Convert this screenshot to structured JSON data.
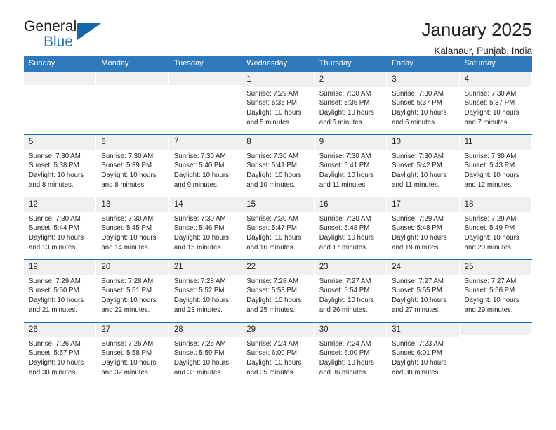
{
  "brand": {
    "name_top": "General",
    "name_bottom": "Blue",
    "triangle_color": "#1567ab",
    "blue_text_color": "#2572b6"
  },
  "header": {
    "title": "January 2025",
    "subtitle": "Kalanaur, Punjab, India"
  },
  "theme": {
    "header_band": "#2f79bd",
    "row_divider": "#1d6cae",
    "daynum_band": "#f0f0f0"
  },
  "weekdays": [
    "Sunday",
    "Monday",
    "Tuesday",
    "Wednesday",
    "Thursday",
    "Friday",
    "Saturday"
  ],
  "weeks": [
    [
      {
        "day": "",
        "sunrise": "",
        "sunset": "",
        "daylight1": "",
        "daylight2": ""
      },
      {
        "day": "",
        "sunrise": "",
        "sunset": "",
        "daylight1": "",
        "daylight2": ""
      },
      {
        "day": "",
        "sunrise": "",
        "sunset": "",
        "daylight1": "",
        "daylight2": ""
      },
      {
        "day": "1",
        "sunrise": "Sunrise: 7:29 AM",
        "sunset": "Sunset: 5:35 PM",
        "daylight1": "Daylight: 10 hours",
        "daylight2": "and 5 minutes."
      },
      {
        "day": "2",
        "sunrise": "Sunrise: 7:30 AM",
        "sunset": "Sunset: 5:36 PM",
        "daylight1": "Daylight: 10 hours",
        "daylight2": "and 6 minutes."
      },
      {
        "day": "3",
        "sunrise": "Sunrise: 7:30 AM",
        "sunset": "Sunset: 5:37 PM",
        "daylight1": "Daylight: 10 hours",
        "daylight2": "and 6 minutes."
      },
      {
        "day": "4",
        "sunrise": "Sunrise: 7:30 AM",
        "sunset": "Sunset: 5:37 PM",
        "daylight1": "Daylight: 10 hours",
        "daylight2": "and 7 minutes."
      }
    ],
    [
      {
        "day": "5",
        "sunrise": "Sunrise: 7:30 AM",
        "sunset": "Sunset: 5:38 PM",
        "daylight1": "Daylight: 10 hours",
        "daylight2": "and 8 minutes."
      },
      {
        "day": "6",
        "sunrise": "Sunrise: 7:30 AM",
        "sunset": "Sunset: 5:39 PM",
        "daylight1": "Daylight: 10 hours",
        "daylight2": "and 8 minutes."
      },
      {
        "day": "7",
        "sunrise": "Sunrise: 7:30 AM",
        "sunset": "Sunset: 5:40 PM",
        "daylight1": "Daylight: 10 hours",
        "daylight2": "and 9 minutes."
      },
      {
        "day": "8",
        "sunrise": "Sunrise: 7:30 AM",
        "sunset": "Sunset: 5:41 PM",
        "daylight1": "Daylight: 10 hours",
        "daylight2": "and 10 minutes."
      },
      {
        "day": "9",
        "sunrise": "Sunrise: 7:30 AM",
        "sunset": "Sunset: 5:41 PM",
        "daylight1": "Daylight: 10 hours",
        "daylight2": "and 11 minutes."
      },
      {
        "day": "10",
        "sunrise": "Sunrise: 7:30 AM",
        "sunset": "Sunset: 5:42 PM",
        "daylight1": "Daylight: 10 hours",
        "daylight2": "and 11 minutes."
      },
      {
        "day": "11",
        "sunrise": "Sunrise: 7:30 AM",
        "sunset": "Sunset: 5:43 PM",
        "daylight1": "Daylight: 10 hours",
        "daylight2": "and 12 minutes."
      }
    ],
    [
      {
        "day": "12",
        "sunrise": "Sunrise: 7:30 AM",
        "sunset": "Sunset: 5:44 PM",
        "daylight1": "Daylight: 10 hours",
        "daylight2": "and 13 minutes."
      },
      {
        "day": "13",
        "sunrise": "Sunrise: 7:30 AM",
        "sunset": "Sunset: 5:45 PM",
        "daylight1": "Daylight: 10 hours",
        "daylight2": "and 14 minutes."
      },
      {
        "day": "14",
        "sunrise": "Sunrise: 7:30 AM",
        "sunset": "Sunset: 5:46 PM",
        "daylight1": "Daylight: 10 hours",
        "daylight2": "and 15 minutes."
      },
      {
        "day": "15",
        "sunrise": "Sunrise: 7:30 AM",
        "sunset": "Sunset: 5:47 PM",
        "daylight1": "Daylight: 10 hours",
        "daylight2": "and 16 minutes."
      },
      {
        "day": "16",
        "sunrise": "Sunrise: 7:30 AM",
        "sunset": "Sunset: 5:48 PM",
        "daylight1": "Daylight: 10 hours",
        "daylight2": "and 17 minutes."
      },
      {
        "day": "17",
        "sunrise": "Sunrise: 7:29 AM",
        "sunset": "Sunset: 5:48 PM",
        "daylight1": "Daylight: 10 hours",
        "daylight2": "and 19 minutes."
      },
      {
        "day": "18",
        "sunrise": "Sunrise: 7:29 AM",
        "sunset": "Sunset: 5:49 PM",
        "daylight1": "Daylight: 10 hours",
        "daylight2": "and 20 minutes."
      }
    ],
    [
      {
        "day": "19",
        "sunrise": "Sunrise: 7:29 AM",
        "sunset": "Sunset: 5:50 PM",
        "daylight1": "Daylight: 10 hours",
        "daylight2": "and 21 minutes."
      },
      {
        "day": "20",
        "sunrise": "Sunrise: 7:28 AM",
        "sunset": "Sunset: 5:51 PM",
        "daylight1": "Daylight: 10 hours",
        "daylight2": "and 22 minutes."
      },
      {
        "day": "21",
        "sunrise": "Sunrise: 7:28 AM",
        "sunset": "Sunset: 5:52 PM",
        "daylight1": "Daylight: 10 hours",
        "daylight2": "and 23 minutes."
      },
      {
        "day": "22",
        "sunrise": "Sunrise: 7:28 AM",
        "sunset": "Sunset: 5:53 PM",
        "daylight1": "Daylight: 10 hours",
        "daylight2": "and 25 minutes."
      },
      {
        "day": "23",
        "sunrise": "Sunrise: 7:27 AM",
        "sunset": "Sunset: 5:54 PM",
        "daylight1": "Daylight: 10 hours",
        "daylight2": "and 26 minutes."
      },
      {
        "day": "24",
        "sunrise": "Sunrise: 7:27 AM",
        "sunset": "Sunset: 5:55 PM",
        "daylight1": "Daylight: 10 hours",
        "daylight2": "and 27 minutes."
      },
      {
        "day": "25",
        "sunrise": "Sunrise: 7:27 AM",
        "sunset": "Sunset: 5:56 PM",
        "daylight1": "Daylight: 10 hours",
        "daylight2": "and 29 minutes."
      }
    ],
    [
      {
        "day": "26",
        "sunrise": "Sunrise: 7:26 AM",
        "sunset": "Sunset: 5:57 PM",
        "daylight1": "Daylight: 10 hours",
        "daylight2": "and 30 minutes."
      },
      {
        "day": "27",
        "sunrise": "Sunrise: 7:26 AM",
        "sunset": "Sunset: 5:58 PM",
        "daylight1": "Daylight: 10 hours",
        "daylight2": "and 32 minutes."
      },
      {
        "day": "28",
        "sunrise": "Sunrise: 7:25 AM",
        "sunset": "Sunset: 5:59 PM",
        "daylight1": "Daylight: 10 hours",
        "daylight2": "and 33 minutes."
      },
      {
        "day": "29",
        "sunrise": "Sunrise: 7:24 AM",
        "sunset": "Sunset: 6:00 PM",
        "daylight1": "Daylight: 10 hours",
        "daylight2": "and 35 minutes."
      },
      {
        "day": "30",
        "sunrise": "Sunrise: 7:24 AM",
        "sunset": "Sunset: 6:00 PM",
        "daylight1": "Daylight: 10 hours",
        "daylight2": "and 36 minutes."
      },
      {
        "day": "31",
        "sunrise": "Sunrise: 7:23 AM",
        "sunset": "Sunset: 6:01 PM",
        "daylight1": "Daylight: 10 hours",
        "daylight2": "and 38 minutes."
      },
      {
        "day": "",
        "sunrise": "",
        "sunset": "",
        "daylight1": "",
        "daylight2": ""
      }
    ]
  ]
}
